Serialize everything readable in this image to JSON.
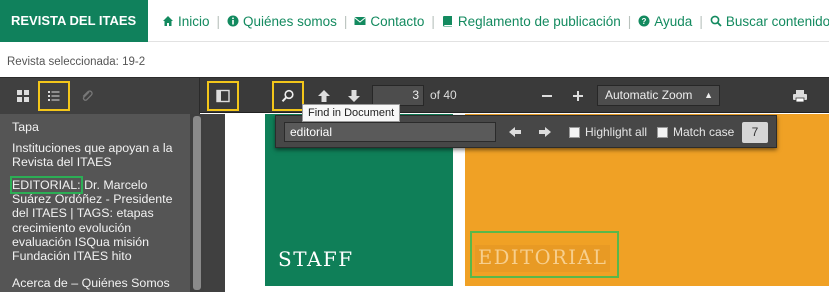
{
  "nav": {
    "brand": "REVISTA DEL ITAES",
    "links": [
      {
        "icon": "home-icon",
        "label": "Inicio"
      },
      {
        "icon": "info-circle-icon",
        "label": "Quiénes somos"
      },
      {
        "icon": "envelope-icon",
        "label": "Contacto"
      },
      {
        "icon": "book-icon",
        "label": "Reglamento de publicación"
      },
      {
        "icon": "question-circle-icon",
        "label": "Ayuda"
      },
      {
        "icon": "search-icon",
        "label": "Buscar contenido"
      }
    ]
  },
  "magazine": {
    "label": "Revista seleccionada:",
    "value": "19-2"
  },
  "toolbar": {
    "page_number": "3",
    "page_count": "of 40",
    "zoom": "Automatic Zoom",
    "tooltip": "Find in Document"
  },
  "findbar": {
    "query": "editorial",
    "highlight_all": "Highlight all",
    "match_case": "Match case",
    "count": "7"
  },
  "outline": {
    "items": [
      "Tapa",
      "Instituciones que apoyan a la Revista del ITAES",
      "EDITORIAL: Dr. Marcelo Suárez Ordóñez - Presidente del ITAES | TAGS: etapas crecimiento evolución evaluación ISQua misión Fundación ITAES hito",
      "Acerca de – Quiénes Somos"
    ],
    "editorial_prefix": "EDITORIAL:",
    "editorial_rest": " Dr. Marcelo Suárez Ordóñez - Presidente del ITAES | TAGS: etapas crecimiento evolución evaluación ISQua misión Fundación ITAES hito"
  },
  "document": {
    "staff_title": "STAFF",
    "editorial_title": "EDITORIAL"
  },
  "colors": {
    "brand_green": "#10815c",
    "link_green": "#138a5f",
    "highlight_yellow": "#f3c61a",
    "annotation_green": "#2cae55",
    "editorial_orange": "#f0a125"
  }
}
